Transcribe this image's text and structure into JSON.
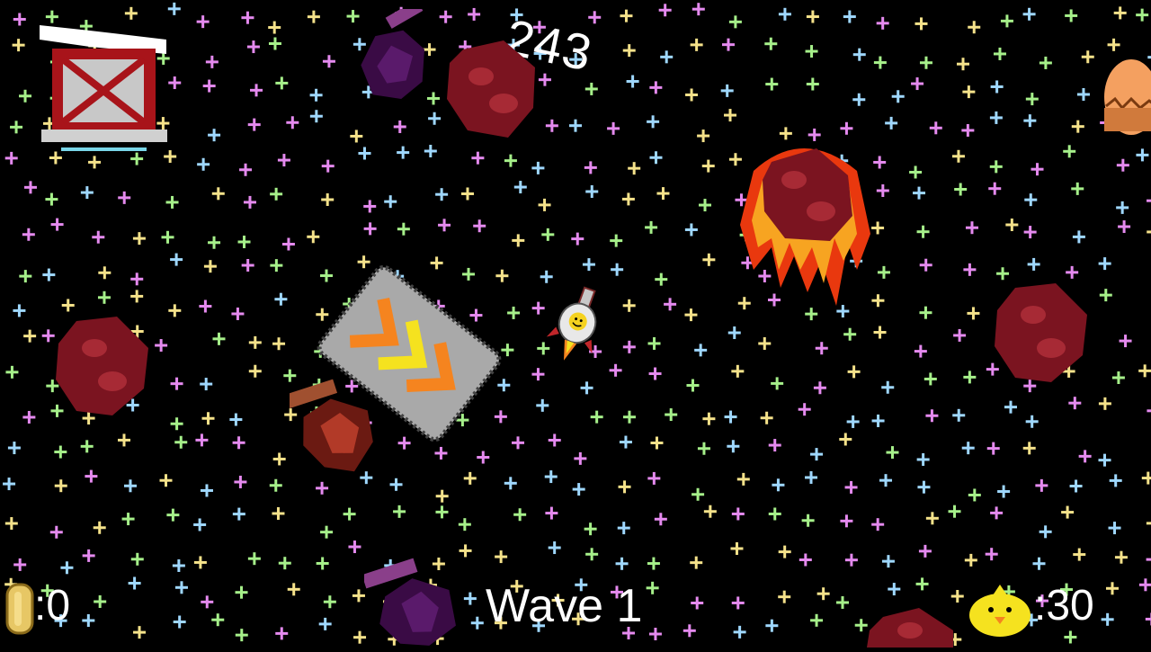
{
  "hud": {
    "score": "243",
    "wave_label": "Wave 1",
    "coins": ":0",
    "chickens": ":30"
  },
  "icons": {
    "shop_button": "shop-crate-icon",
    "coin": "coin-icon",
    "chicken": "chick-icon",
    "egg": "egg-icon"
  },
  "colors": {
    "background": "#000000",
    "star_colors": [
      "#e58aef",
      "#9fd8ff",
      "#a6f08a",
      "#f5e28a"
    ],
    "asteroid": "#7b1420",
    "text": "#ffffff"
  }
}
